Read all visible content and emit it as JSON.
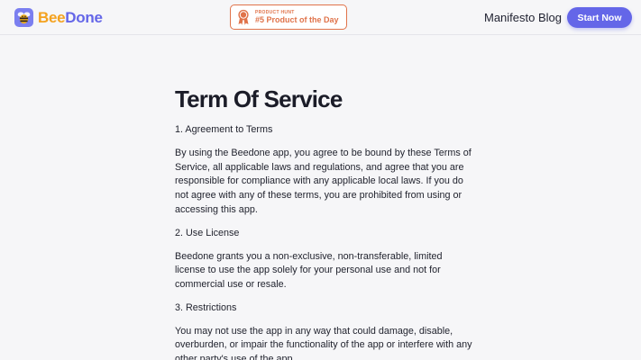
{
  "header": {
    "logo": {
      "part1": "Bee",
      "part2": "Done",
      "icon": "bee-icon"
    },
    "badge": {
      "small_text": "PRODUCT HUNT",
      "big_text": "#5 Product of the Day",
      "icon": "medal-icon"
    },
    "nav": [
      {
        "label": "Manifesto"
      },
      {
        "label": "Blog"
      }
    ],
    "cta_label": "Start Now"
  },
  "colors": {
    "accent": "#6466e8",
    "logo_bee": "#f4a21f",
    "badge": "#e0734a",
    "background": "#f6f6f8"
  },
  "main": {
    "title": "Term Of Service",
    "sections": [
      {
        "heading": "1. Agreement to Terms",
        "text": "By using the Beedone app, you agree to be bound by these Terms of Service, all applicable laws and regulations, and agree that you are responsible for compliance with any applicable local laws. If you do not agree with any of these terms, you are prohibited from using or accessing this app."
      },
      {
        "heading": "2. Use License",
        "text": "Beedone grants you a non-exclusive, non-transferable, limited license to use the app solely for your personal use and not for commercial use or resale."
      },
      {
        "heading": "3. Restrictions",
        "text": "You may not use the app in any way that could damage, disable, overburden, or impair the functionality of the app or interfere with any other party's use of the app."
      }
    ]
  }
}
